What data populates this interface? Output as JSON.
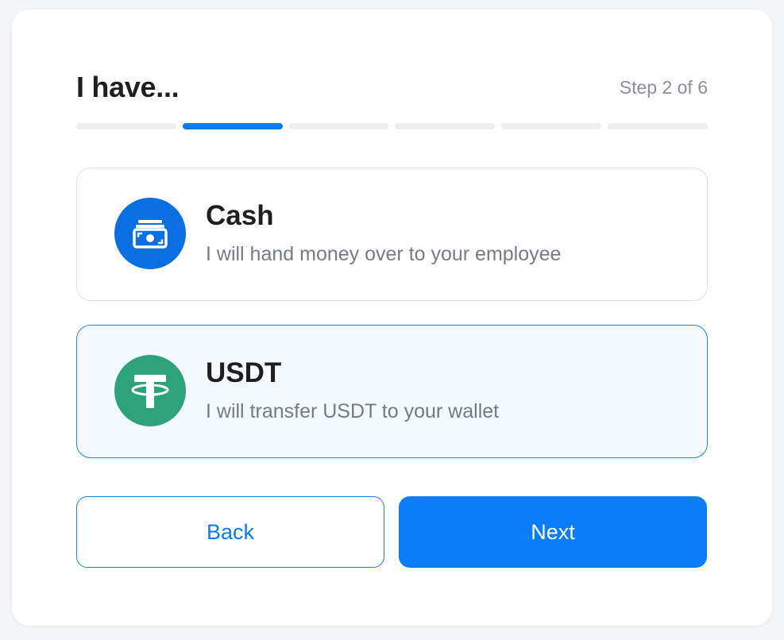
{
  "header": {
    "title": "I have...",
    "step_label": "Step 2 of 6"
  },
  "progress": {
    "total_steps": 6,
    "current_step": 2,
    "active_color": "#0a7bf0",
    "inactive_color": "#eeeeee"
  },
  "options": [
    {
      "title": "Cash",
      "description": "I will hand money over to your employee",
      "icon": "cash-icon",
      "icon_color": "#0a6fe0",
      "selected": false
    },
    {
      "title": "USDT",
      "description": "I will transfer USDT to your wallet",
      "icon": "tether-icon",
      "icon_color": "#2ea27a",
      "selected": true
    }
  ],
  "buttons": {
    "back_label": "Back",
    "next_label": "Next"
  },
  "colors": {
    "accent": "#0a7dfb",
    "selected_bg": "#f3f9fe",
    "selected_border": "#1e86ea"
  }
}
